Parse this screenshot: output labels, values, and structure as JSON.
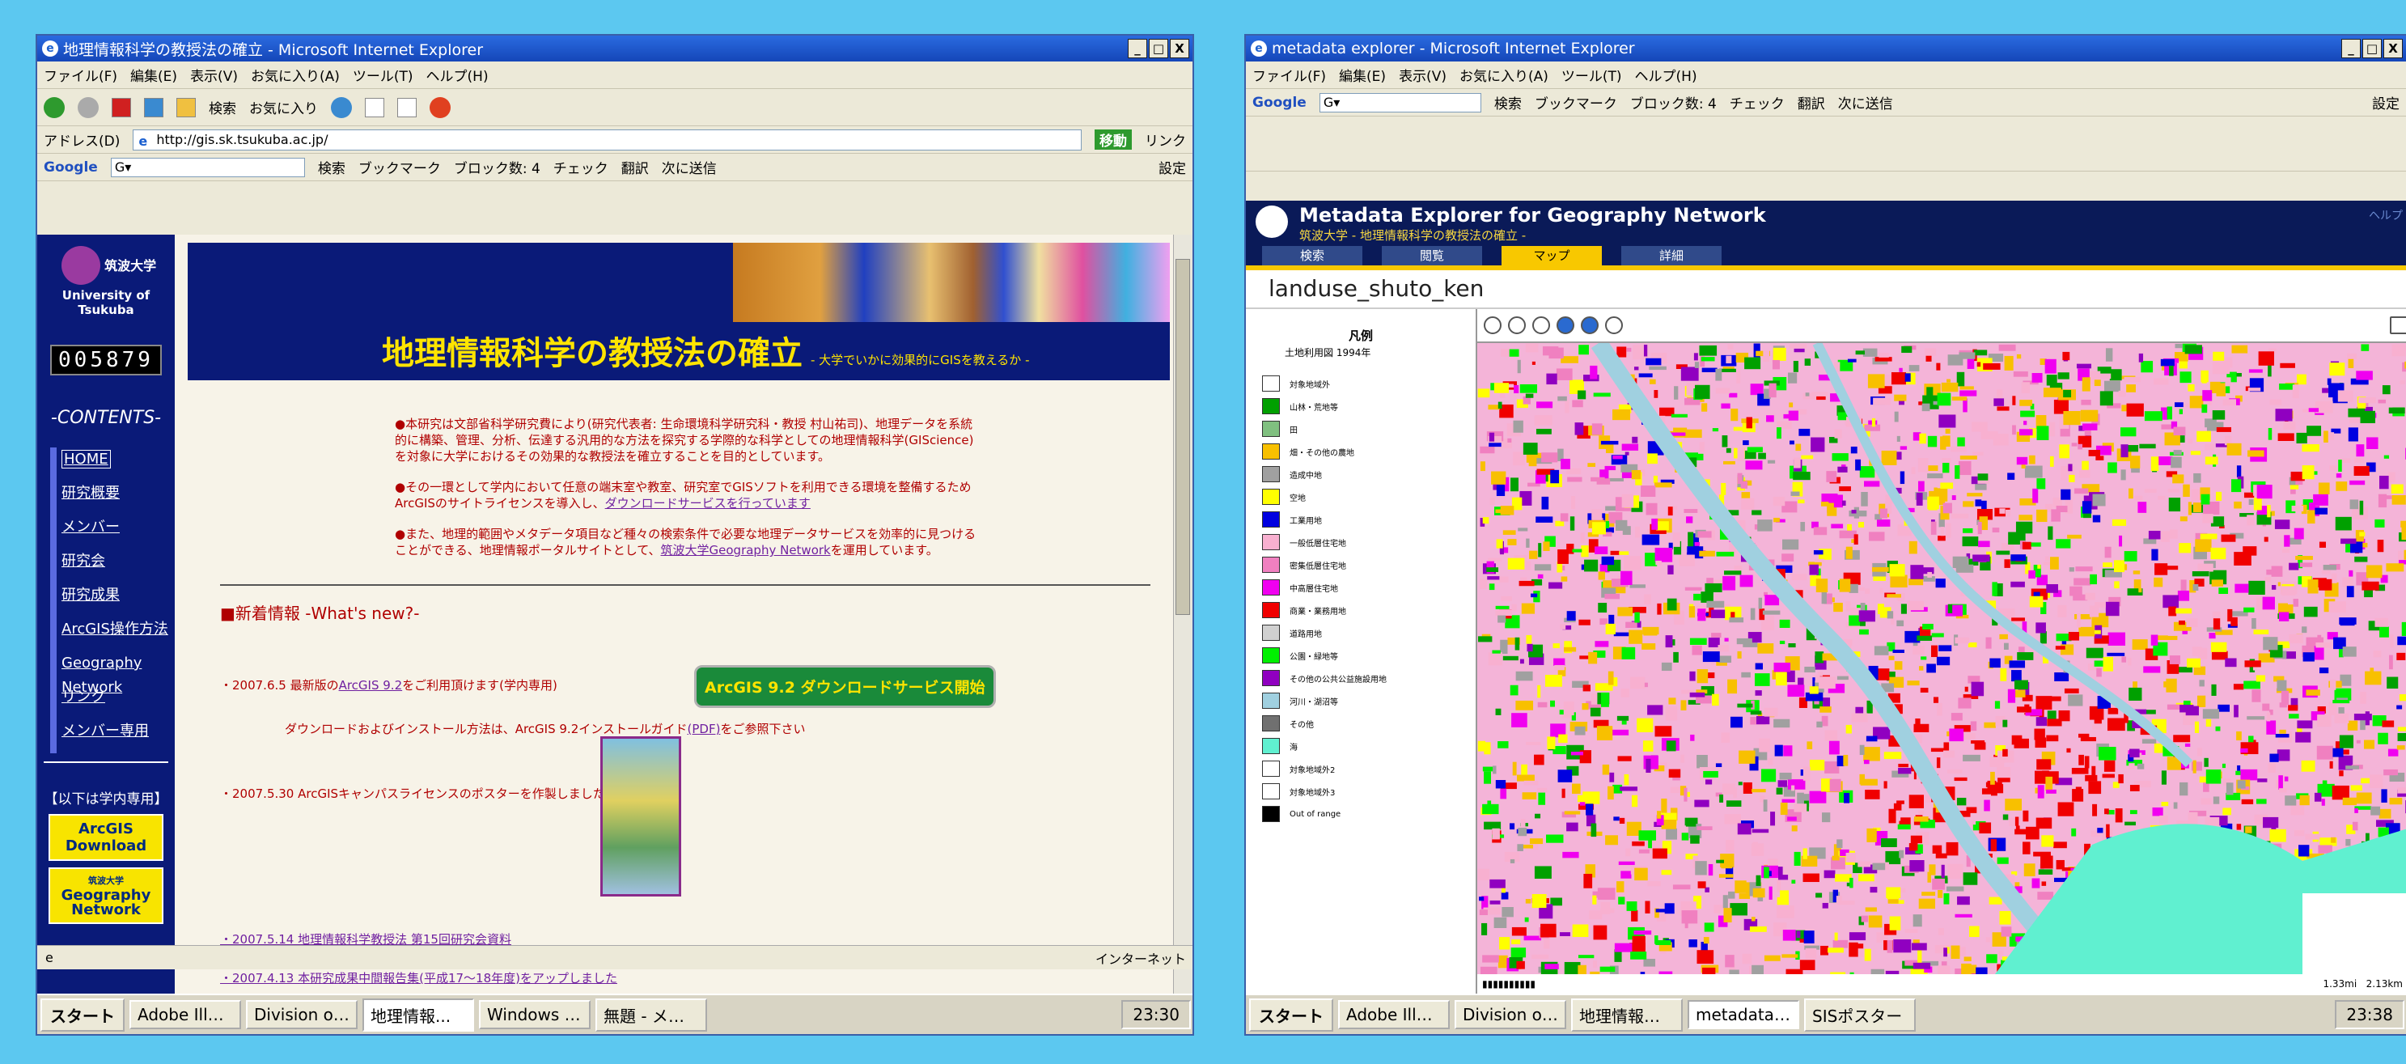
{
  "left_window": {
    "title": "地理情報科学の教授法の確立 - Microsoft Internet Explorer",
    "menu": [
      "ファイル(F)",
      "編集(E)",
      "表示(V)",
      "お気に入り(A)",
      "ツール(T)",
      "ヘルプ(H)"
    ],
    "toolbar": {
      "search_label": "検索",
      "favorites_label": "お気に入り"
    },
    "address": {
      "label": "アドレス(D)",
      "url": "http://gis.sk.tsukuba.ac.jp/",
      "go_label": "移動",
      "links_label": "リンク"
    },
    "google_bar": {
      "logo": "Google",
      "search_label": "検索",
      "bookmarks": "ブックマーク",
      "blocked": "ブロック数: 4",
      "check": "チェック",
      "translate": "翻訳",
      "send": "次に送信",
      "settings": "設定"
    },
    "status": {
      "zone": "インターネット"
    }
  },
  "site": {
    "university_jp": "筑波大学",
    "university_en": "University of Tsukuba",
    "counter": "005879",
    "contents_label": "-CONTENTS-",
    "nav": [
      "HOME",
      "研究概要",
      "メンバー",
      "研究会",
      "研究成果",
      "ArcGIS操作方法",
      "Geography Network",
      "リンク",
      "メンバー専用"
    ],
    "internal_note": "【以下は学内専用】",
    "arcgis_download_btn": "ArcGIS Download",
    "geo_network_btn_small": "筑波大学",
    "geo_network_btn": "Geography Network",
    "banner_title": "地理情報科学の教授法の確立",
    "banner_subtitle": "- 大学でいかに効果的にGISを教えるか -",
    "intro1": "●本研究は文部省科学研究費により(研究代表者: 生命環境科学研究科・教授 村山祐司)、地理データを系統的に構築、管理、分析、伝達する汎用的な方法を探究する学際的な科学としての地理情報科学(GIScience)を対象に大学におけるその効果的な教授法を確立することを目的としています。",
    "intro2_a": "●その一環として学内において任意の端末室や教室、研究室でGISソフトを利用できる環境を整備するためArcGISのサイトライセンスを導入し、",
    "intro2_link": "ダウンロードサービスを行っています",
    "intro3_a": "●また、地理的範囲やメタデータ項目など種々の検索条件で必要な地理データサービスを効率的に見つけることができる、地理情報ポータルサイトとして、",
    "intro3_link": "筑波大学Geography Network",
    "intro3_b": "を運用しています。",
    "news_heading": "■新着情報 -What's new?-",
    "news1_a": "・2007.6.5 最新版の",
    "news1_link": "ArcGIS 9.2",
    "news1_b": "をご利用頂けます(学内専用)",
    "news1_sub_a": "ダウンロードおよびインストール方法は、ArcGIS 9.2インストールガイド",
    "news1_sub_link": "(PDF)",
    "news1_sub_b": "をご参照下さい",
    "download_banner": "ArcGIS 9.2 ダウンロードサービス開始",
    "news2": "・2007.5.30 ArcGISキャンパスライセンスのポスターを作製しました(PDF)",
    "news3": "・2007.5.14 地理情報科学教授法 第15回研究会資料",
    "news4": "・2007.4.13 本研究成果中間報告集(平成17〜18年度)をアップしました"
  },
  "right_window": {
    "title": "metadata explorer - Microsoft Internet Explorer",
    "menu": [
      "ファイル(F)",
      "編集(E)",
      "表示(V)",
      "お気に入り(A)",
      "ツール(T)",
      "ヘルプ(H)"
    ],
    "google_bar": {
      "logo": "Google",
      "search_label": "検索",
      "bookmarks": "ブックマーク",
      "blocked": "ブロック数: 4",
      "check": "チェック",
      "translate": "翻訳",
      "send": "次に送信",
      "settings": "設定"
    },
    "app_title": "Metadata Explorer for Geography Network",
    "app_subtitle": "筑波大学 - 地理情報科学の教授法の確立 -",
    "help": "ヘルプ",
    "tabs": [
      "検索",
      "閲覧",
      "マップ",
      "詳細"
    ],
    "active_tab": "マップ",
    "layer_name": "landuse_shuto_ken",
    "legend_title": "凡例",
    "legend_subtitle": "土地利用図 1994年",
    "legend": [
      {
        "label": "対象地域外",
        "color": "#ffffff"
      },
      {
        "label": "山林・荒地等",
        "color": "#00a000"
      },
      {
        "label": "田",
        "color": "#80c080"
      },
      {
        "label": "畑・その他の農地",
        "color": "#f8c000"
      },
      {
        "label": "造成中地",
        "color": "#a0a0a0"
      },
      {
        "label": "空地",
        "color": "#ffff00"
      },
      {
        "label": "工業用地",
        "color": "#0000e0"
      },
      {
        "label": "一般低層住宅地",
        "color": "#f8b0d0"
      },
      {
        "label": "密集低層住宅地",
        "color": "#f080c0"
      },
      {
        "label": "中高層住宅地",
        "color": "#f000f0"
      },
      {
        "label": "商業・業務用地",
        "color": "#f00000"
      },
      {
        "label": "道路用地",
        "color": "#d0d0d0"
      },
      {
        "label": "公園・緑地等",
        "color": "#00f000"
      },
      {
        "label": "その他の公共公益施設用地",
        "color": "#9000c0"
      },
      {
        "label": "河川・湖沼等",
        "color": "#a0d0e0"
      },
      {
        "label": "その他",
        "color": "#707070"
      },
      {
        "label": "海",
        "color": "#60f0d0"
      },
      {
        "label": "対象地域外2",
        "color": "#ffffff"
      },
      {
        "label": "対象地域外3",
        "color": "#ffffff"
      },
      {
        "label": "Out of range",
        "color": "#000000"
      }
    ],
    "scale_a": "1.33mi",
    "scale_b": "2.13km"
  },
  "taskbar_left": {
    "start": "スタート",
    "buttons": [
      "Adobe Illustr...",
      "Division of S...",
      "地理情報...",
      "Windows Me...",
      "無題 - メモ帳"
    ],
    "active": 2,
    "clock": "23:30"
  },
  "taskbar_right": {
    "start": "スタート",
    "buttons": [
      "Adobe Illustr...",
      "Division of S...",
      "地理情報科...",
      "metadata ...",
      "SISポスター"
    ],
    "active": 3,
    "clock": "23:38"
  }
}
